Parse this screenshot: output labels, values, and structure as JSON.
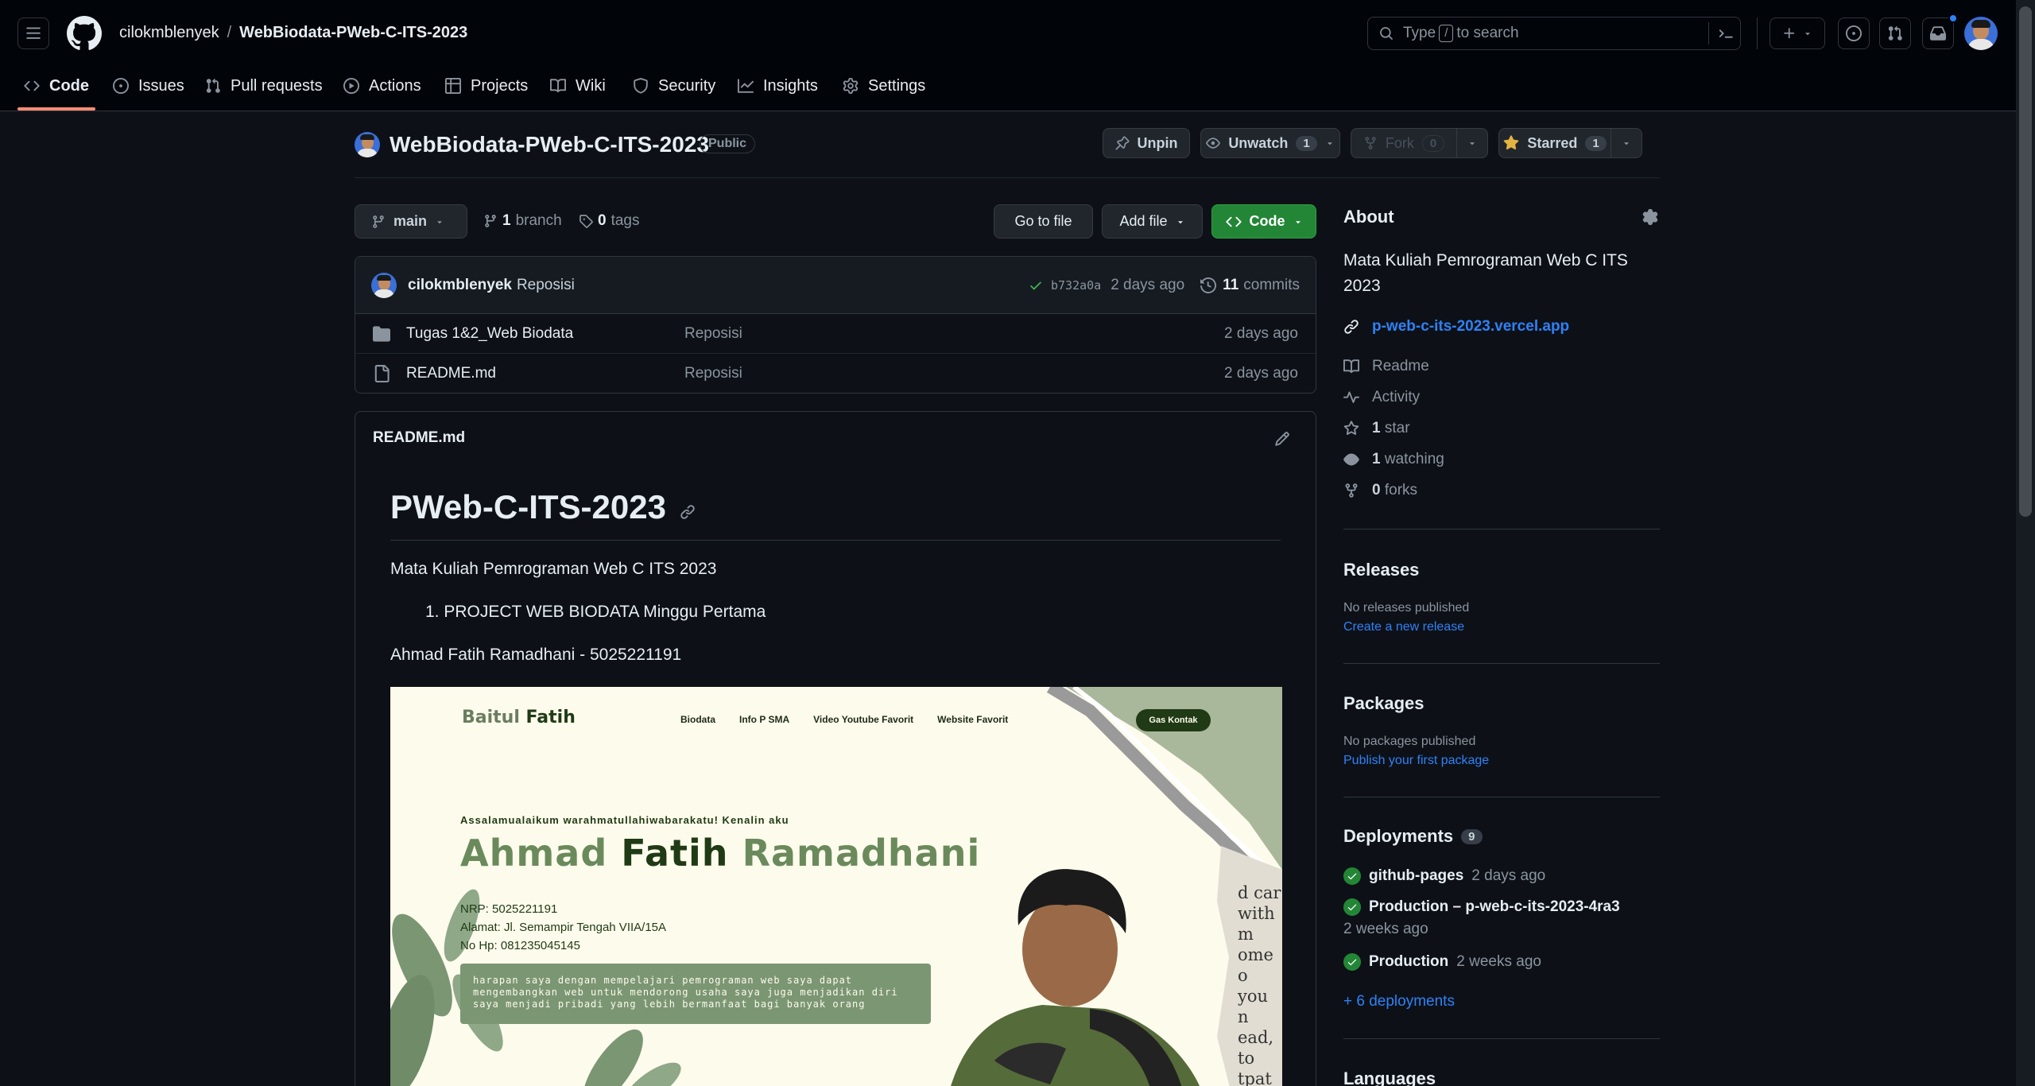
{
  "header": {
    "owner": "cilokmblenyek",
    "separator": "/",
    "repo": "WebBiodata-PWeb-C-ITS-2023",
    "search_prefix": "Type",
    "search_key": "/",
    "search_suffix": "to search"
  },
  "tabs": [
    {
      "label": "Code",
      "icon": "code-icon"
    },
    {
      "label": "Issues",
      "icon": "issue-opened-icon"
    },
    {
      "label": "Pull requests",
      "icon": "git-pull-request-icon"
    },
    {
      "label": "Actions",
      "icon": "play-icon"
    },
    {
      "label": "Projects",
      "icon": "table-icon"
    },
    {
      "label": "Wiki",
      "icon": "book-icon"
    },
    {
      "label": "Security",
      "icon": "shield-icon"
    },
    {
      "label": "Insights",
      "icon": "graph-icon"
    },
    {
      "label": "Settings",
      "icon": "gear-icon"
    }
  ],
  "repo": {
    "name": "WebBiodata-PWeb-C-ITS-2023",
    "visibility": "Public",
    "unpin": "Unpin",
    "unwatch": "Unwatch",
    "watch_count": "1",
    "fork": "Fork",
    "fork_count": "0",
    "starred": "Starred",
    "star_count": "1"
  },
  "toolbar": {
    "branch": "main",
    "branch_count": "1",
    "branch_label": "branch",
    "tag_count": "0",
    "tag_label": "tags",
    "go_to_file": "Go to file",
    "add_file": "Add file",
    "code": "Code"
  },
  "commit": {
    "author": "cilokmblenyek",
    "message": "Reposisi",
    "sha": "b732a0a",
    "time": "2 days ago",
    "count": "11",
    "count_label": "commits"
  },
  "files": [
    {
      "name": "Tugas 1&2_Web Biodata",
      "type": "folder",
      "message": "Reposisi",
      "time": "2 days ago"
    },
    {
      "name": "README.md",
      "type": "file",
      "message": "Reposisi",
      "time": "2 days ago"
    }
  ],
  "readme": {
    "filename": "README.md",
    "title": "PWeb-C-ITS-2023",
    "desc": "Mata Kuliah Pemrograman Web C ITS 2023",
    "list_item": "1. PROJECT WEB BIODATA Minggu Pertama",
    "author_line": "Ahmad Fatih Ramadhani - 5025221191",
    "preview": {
      "brand_a": "Baitul",
      "brand_b": "Fatih",
      "nav": [
        "Biodata",
        "Info P SMA",
        "Video Youtube Favorit",
        "Website Favorit"
      ],
      "cta": "Gas Kontak",
      "greeting": "Assalamualaikum warahmatullahiwabarakatu! Kenalin aku",
      "name_a": "Ahmad",
      "name_b": "Fatih",
      "name_c": "Ramadhani",
      "nrp": "NRP: 5025221191",
      "alamat": "Alamat: Jl. Semampir Tengah VIIA/15A",
      "hp": "No Hp: 081235045145",
      "quote": "harapan saya dengan mempelajari pemrograman web saya dapat mengembangkan web untuk mendorong usaha saya juga menjadikan diri saya menjadi pribadi yang lebih bermanfaat bagi banyak orang",
      "paper_text": "d car with m ome o you n ead, to tpath"
    }
  },
  "about": {
    "heading": "About",
    "description": "Mata Kuliah Pemrograman Web C ITS 2023",
    "website": "p-web-c-its-2023.vercel.app",
    "readme": "Readme",
    "activity": "Activity",
    "stars_n": "1",
    "stars": "star",
    "watching_n": "1",
    "watching": "watching",
    "forks_n": "0",
    "forks": "forks"
  },
  "releases": {
    "heading": "Releases",
    "none": "No releases published",
    "create": "Create a new release"
  },
  "packages": {
    "heading": "Packages",
    "none": "No packages published",
    "publish": "Publish your first package"
  },
  "deployments": {
    "heading": "Deployments",
    "count": "9",
    "items": [
      {
        "name": "github-pages",
        "time": "2 days ago"
      },
      {
        "name": "Production – p-web-c-its-2023-4ra3",
        "time": "2 weeks ago"
      },
      {
        "name": "Production",
        "time": "2 weeks ago"
      }
    ],
    "more": "+ 6 deployments"
  },
  "languages": {
    "heading": "Languages"
  },
  "colors": {
    "bg": "#0d1117",
    "header_bg": "#010409",
    "border": "#30363d",
    "accent": "#2f81f7",
    "green": "#238636",
    "tab_underline": "#fd8c73"
  }
}
